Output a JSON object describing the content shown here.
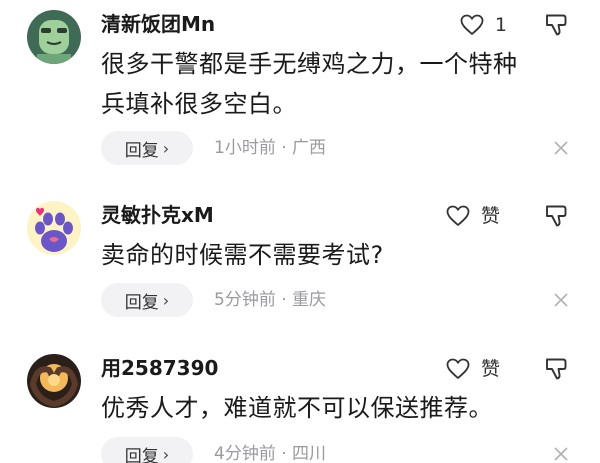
{
  "comments": [
    {
      "username": "清新饭团Mn",
      "like_label": "1",
      "content_lines": [
        "很多干警都是手无缚鸡之力，一个特种",
        "兵填补很多空白。"
      ],
      "reply_label": "回复",
      "reply_chevron": "›",
      "meta": "1小时前 · 广西",
      "avatar_icon": "green-cartoon-avatar-icon"
    },
    {
      "username": "灵敏扑克xM",
      "like_label": "赞",
      "content_lines": [
        "卖命的时候需不需要考试?"
      ],
      "reply_label": "回复",
      "reply_chevron": "›",
      "meta": "5分钟前 · 重庆",
      "avatar_icon": "paw-avatar-icon"
    },
    {
      "username": "用2587390",
      "like_label": "赞",
      "content_lines": [
        "优秀人才，难道就不可以保送推荐。"
      ],
      "reply_label": "回复",
      "reply_chevron": "›",
      "meta": "4分钟前 · 四川",
      "avatar_icon": "heart-hands-avatar-icon"
    }
  ],
  "colors": {
    "text": "#1a1a1a",
    "meta": "#9a9aa0",
    "reply_bg": "#f2f2f4",
    "icon": "#333333"
  }
}
